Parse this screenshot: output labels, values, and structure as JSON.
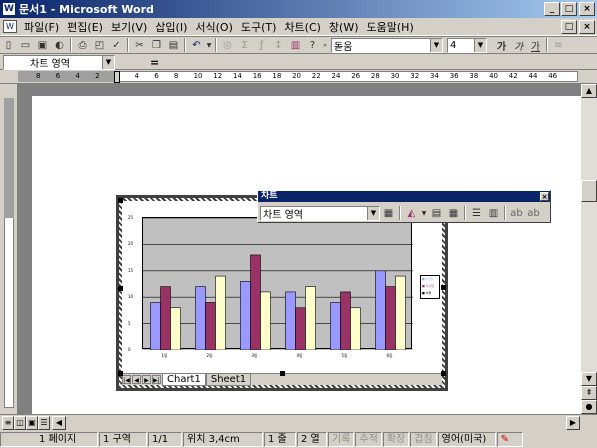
{
  "window": {
    "title": "문서1 - Microsoft Word",
    "icon": "word-doc-icon"
  },
  "menu": [
    {
      "id": "file",
      "label": "파일(F)"
    },
    {
      "id": "edit",
      "label": "편집(E)"
    },
    {
      "id": "view",
      "label": "보기(V)"
    },
    {
      "id": "insert",
      "label": "삽입(I)"
    },
    {
      "id": "format",
      "label": "서식(O)"
    },
    {
      "id": "tools",
      "label": "도구(T)"
    },
    {
      "id": "chart",
      "label": "차트(C)"
    },
    {
      "id": "window",
      "label": "창(W)"
    },
    {
      "id": "help",
      "label": "도움말(H)"
    }
  ],
  "toolbar": {
    "font_name": "돋움",
    "font_size": "4",
    "bold_label": "가",
    "italic_label": "가",
    "underline_label": "가"
  },
  "formula_bar": {
    "name_box": "차트 영역",
    "equals": "="
  },
  "ruler": {
    "ticks": [
      "8",
      "6",
      "4",
      "2",
      "2",
      "4",
      "6",
      "8",
      "10",
      "12",
      "14",
      "16",
      "18",
      "20",
      "22",
      "24",
      "26",
      "28",
      "30",
      "32",
      "34",
      "36",
      "38",
      "40",
      "42",
      "44",
      "46"
    ]
  },
  "chart_toolbar": {
    "title": "차트",
    "object_select": "차트 영역"
  },
  "chart_sheet_tabs": {
    "active": "Chart1",
    "other": "Sheet1"
  },
  "chart_data": {
    "type": "bar",
    "categories": [
      "1동",
      "2동",
      "3동",
      "4동",
      "5동",
      "6동"
    ],
    "series": [
      {
        "values": [
          9,
          12,
          13,
          11,
          9,
          15
        ],
        "color": "#9999ff"
      },
      {
        "values": [
          12,
          9,
          18,
          8,
          11,
          12
        ],
        "color": "#993366"
      },
      {
        "values": [
          8,
          14,
          11,
          12,
          8,
          14
        ],
        "color": "#ffffcc"
      }
    ],
    "ylim": [
      0,
      25
    ],
    "yticks": [
      "0",
      "5",
      "10",
      "15",
      "20",
      "25"
    ],
    "grid": true,
    "legend_position": "right",
    "legend_entries": [
      "■ 1인당",
      "■ 가구당",
      "■ 비율"
    ]
  },
  "statusbar": {
    "page": "1 페이지",
    "section": "1 구역",
    "pages": "1/1",
    "position": "위치 3,4cm",
    "line": "1 줄",
    "column": "2 열",
    "rec": "기록",
    "trk": "추적",
    "ext": "확장",
    "ovr": "겹침",
    "language": "영어(미국)"
  },
  "colors": {
    "titlebar": "#0a246a",
    "face": "#d4d0c8"
  }
}
